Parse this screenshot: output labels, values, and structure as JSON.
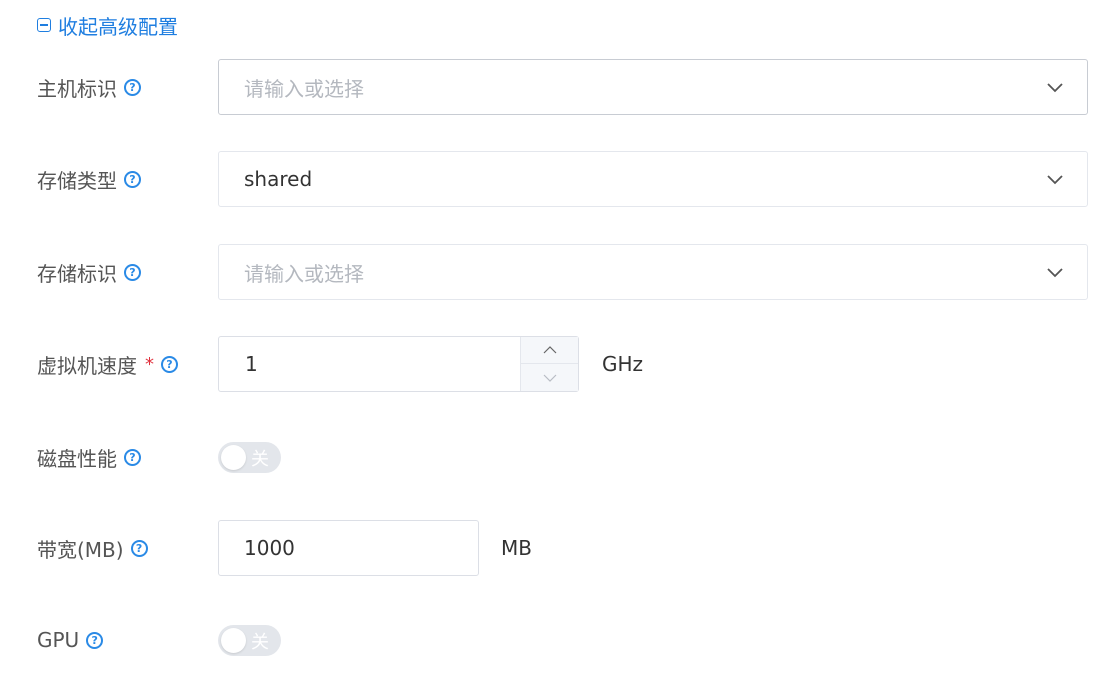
{
  "collapse": {
    "label": "收起高级配置"
  },
  "colors": {
    "link": "#1f7ee0",
    "help": "#2a8ae6",
    "required": "#e0313d",
    "border": "#dcdfe6",
    "placeholder": "#b4b8bf",
    "switch_off": "#e3e6eb"
  },
  "fields": {
    "host_id": {
      "label": "主机标识",
      "placeholder": "请输入或选择",
      "help_icon": "question-circle-icon",
      "dropdown_icon": "chevron-down-icon"
    },
    "storage_type": {
      "label": "存储类型",
      "value": "shared",
      "help_icon": "question-circle-icon",
      "dropdown_icon": "chevron-down-icon"
    },
    "storage_id": {
      "label": "存储标识",
      "placeholder": "请输入或选择",
      "help_icon": "question-circle-icon",
      "dropdown_icon": "chevron-down-icon"
    },
    "vm_speed": {
      "label": "虚拟机速度",
      "required_mark": "*",
      "value": "1",
      "unit": "GHz",
      "help_icon": "question-circle-icon"
    },
    "disk_perf": {
      "label": "磁盘性能",
      "switch_text": "关",
      "enabled": false,
      "help_icon": "question-circle-icon"
    },
    "bandwidth": {
      "label": "带宽(MB)",
      "value": "1000",
      "unit": "MB",
      "help_icon": "question-circle-icon"
    },
    "gpu": {
      "label": "GPU",
      "switch_text": "关",
      "enabled": false,
      "help_icon": "question-circle-icon"
    }
  }
}
